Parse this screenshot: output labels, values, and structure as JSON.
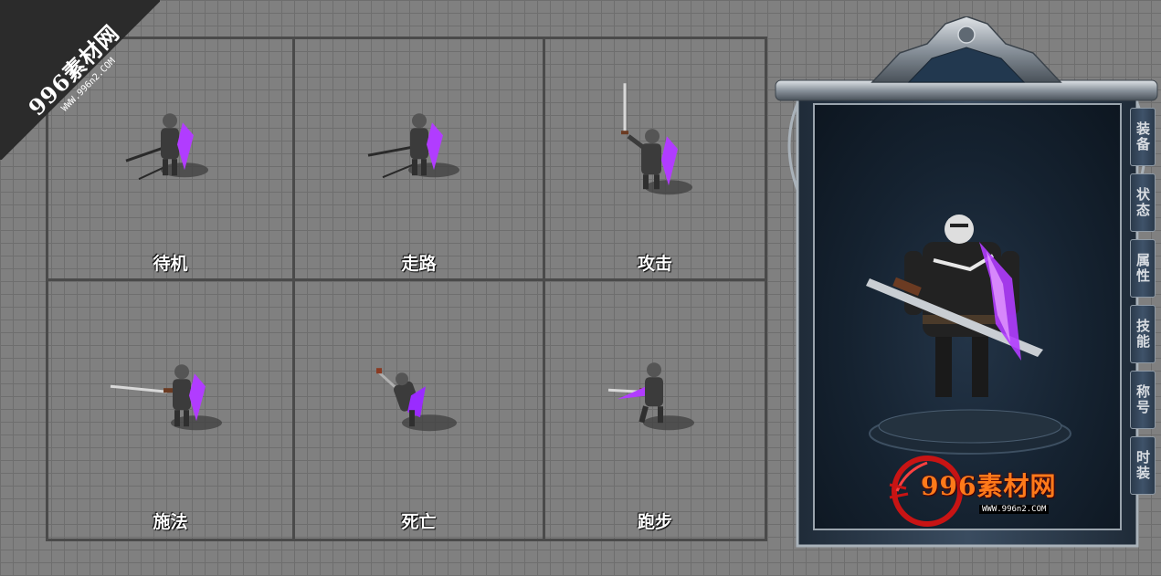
{
  "watermark": {
    "brand": "996素材网",
    "url": "WWW.996n2.COM"
  },
  "grid": {
    "cells": [
      {
        "label": "待机"
      },
      {
        "label": "走路"
      },
      {
        "label": "攻击"
      },
      {
        "label": "施法"
      },
      {
        "label": "死亡"
      },
      {
        "label": "跑步"
      }
    ]
  },
  "panel": {
    "tabs": [
      {
        "label": "装备"
      },
      {
        "label": "状态"
      },
      {
        "label": "属性"
      },
      {
        "label": "技能"
      },
      {
        "label": "称号"
      },
      {
        "label": "时装"
      }
    ],
    "logo": {
      "brand": "996素材网",
      "url": "WWW.996n2.COM"
    }
  },
  "colors": {
    "background": "#808080",
    "grid_line": "#4a4a4a",
    "weapon_glow": "#b13cff",
    "logo_orange": "#ff7a1a",
    "logo_red": "#c81414",
    "viewport_bg": "#152230"
  },
  "icons": {
    "character_sprite": "armored-swordsman-sprite",
    "preview_model": "swordsman-preview-model",
    "frame_ornament": "metal-crest-ornament"
  }
}
